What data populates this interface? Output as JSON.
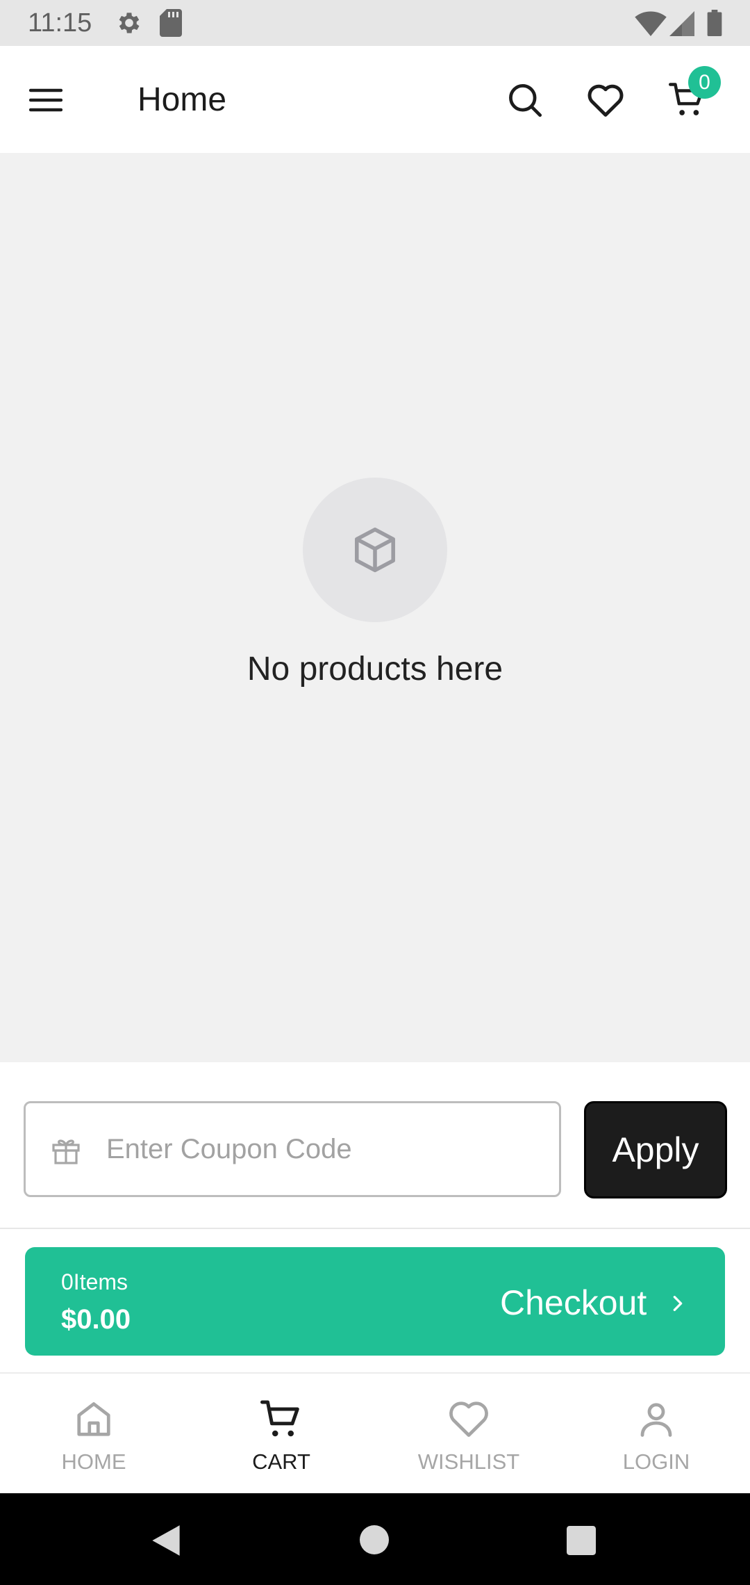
{
  "status_bar": {
    "time": "11:15",
    "icons": [
      "gear-icon",
      "sd-card-icon",
      "wifi-icon",
      "signal-icon",
      "battery-icon"
    ]
  },
  "app_bar": {
    "title": "Home",
    "cart_count": "0",
    "icons": [
      "menu-icon",
      "search-icon",
      "heart-icon",
      "cart-icon"
    ]
  },
  "empty_state": {
    "message": "No products here",
    "icon": "box-icon"
  },
  "coupon": {
    "placeholder": "Enter Coupon Code",
    "value": "",
    "apply_label": "Apply",
    "icon": "gift-icon"
  },
  "checkout": {
    "items_label": "0Items",
    "total": "$0.00",
    "label": "Checkout",
    "icon": "chevron-right-icon"
  },
  "bottom_nav": {
    "items": [
      {
        "label": "HOME",
        "icon": "home-icon",
        "active": false
      },
      {
        "label": "CART",
        "icon": "cart-icon",
        "active": true
      },
      {
        "label": "WISHLIST",
        "icon": "heart-icon",
        "active": false
      },
      {
        "label": "LOGIN",
        "icon": "user-icon",
        "active": false
      }
    ]
  },
  "colors": {
    "accent": "#20c095",
    "dark_button": "#1c1c1c",
    "background": "#f1f1f1",
    "inactive_nav": "#a6a6a6"
  }
}
